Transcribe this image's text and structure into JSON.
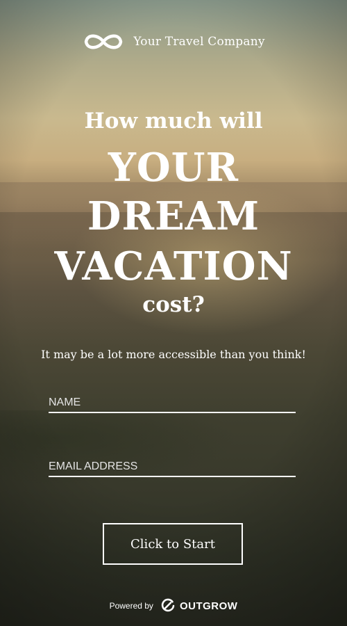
{
  "brand": {
    "name": "Your Travel Company",
    "logo_icon": "infinity-icon"
  },
  "headline": {
    "line1": "How much will",
    "line2": "YOUR",
    "line3": "DREAM",
    "line4": "VACATION",
    "line5": "cost?"
  },
  "subtitle": "It may be a lot more accessible than you think!",
  "form": {
    "name_placeholder": "NAME",
    "email_placeholder": "EMAIL ADDRESS",
    "start_label": "Click to Start"
  },
  "footer": {
    "powered_label": "Powered by",
    "vendor_name": "OUTGROW",
    "vendor_icon": "outgrow-logo-icon"
  }
}
